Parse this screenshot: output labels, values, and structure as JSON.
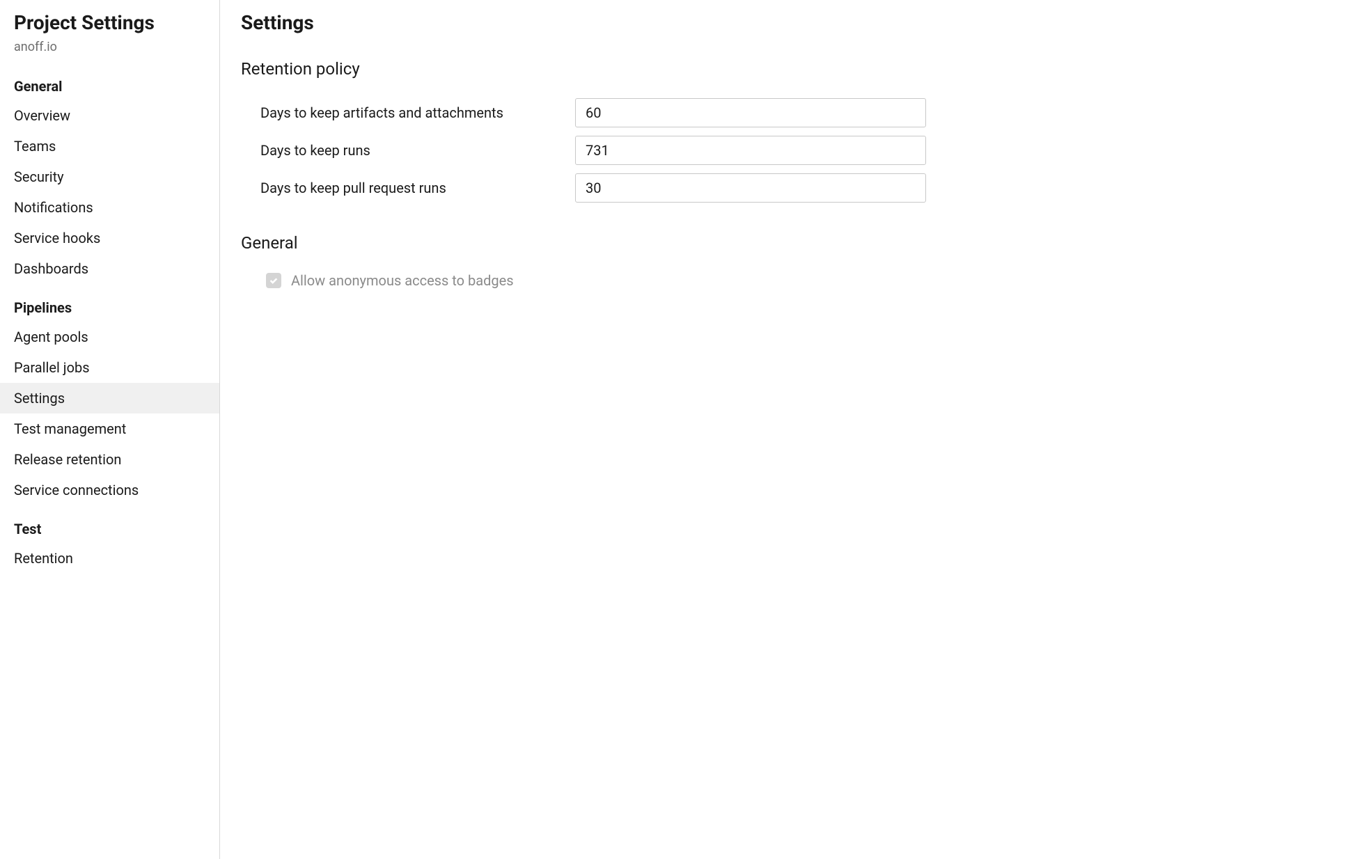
{
  "sidebar": {
    "title": "Project Settings",
    "subtitle": "anoff.io",
    "groups": [
      {
        "header": "General",
        "items": [
          {
            "label": "Overview",
            "active": false
          },
          {
            "label": "Teams",
            "active": false
          },
          {
            "label": "Security",
            "active": false
          },
          {
            "label": "Notifications",
            "active": false
          },
          {
            "label": "Service hooks",
            "active": false
          },
          {
            "label": "Dashboards",
            "active": false
          }
        ]
      },
      {
        "header": "Pipelines",
        "items": [
          {
            "label": "Agent pools",
            "active": false
          },
          {
            "label": "Parallel jobs",
            "active": false
          },
          {
            "label": "Settings",
            "active": true
          },
          {
            "label": "Test management",
            "active": false
          },
          {
            "label": "Release retention",
            "active": false
          },
          {
            "label": "Service connections",
            "active": false
          }
        ]
      },
      {
        "header": "Test",
        "items": [
          {
            "label": "Retention",
            "active": false
          }
        ]
      }
    ]
  },
  "main": {
    "title": "Settings",
    "retention": {
      "heading": "Retention policy",
      "fields": [
        {
          "label": "Days to keep artifacts and attachments",
          "value": "60"
        },
        {
          "label": "Days to keep runs",
          "value": "731"
        },
        {
          "label": "Days to keep pull request runs",
          "value": "30"
        }
      ]
    },
    "general": {
      "heading": "General",
      "checkbox_label": "Allow anonymous access to badges"
    }
  }
}
